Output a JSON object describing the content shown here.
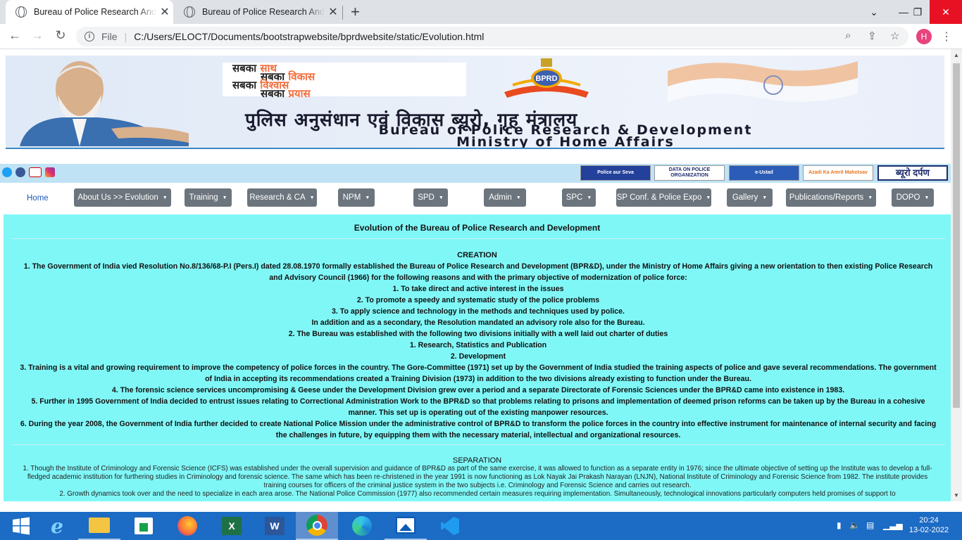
{
  "browser": {
    "tabs": [
      {
        "title": "Bureau of Police Research And Development",
        "active": true
      },
      {
        "title": "Bureau of Police Research And Development",
        "active": false
      }
    ],
    "new_tab": "+",
    "url_label": "File",
    "url": "C:/Users/ELOCT/Documents/bootstrapwebsite/bprdwebsite/static/Evolution.html",
    "profile_initial": "H"
  },
  "banner": {
    "slogan": {
      "line1_a": "सबका",
      "line1_b": "साथ",
      "line2_a": "सबका",
      "line2_b": "विकास",
      "line3_a": "सबका",
      "line3_b": "विश्वास",
      "line4_a": "सबका",
      "line4_b": "प्रयास"
    },
    "logo_text": "BPRD",
    "hindi_title": "पुलिस अनुसंधान एवं विकास ब्यूरो, गृह मंत्रालय",
    "en_title_1": "Bureau of Police Research & Development",
    "en_title_2": "Ministry of Home Affairs"
  },
  "partners": {
    "p1": "Police aur Seva",
    "p2": "DATA ON POLICE ORGANIZATION",
    "p3": "e-Ustad",
    "p4": "Azadi Ka Amrit Mahotsav",
    "p5": "ब्यूरो दर्पण"
  },
  "nav": {
    "home": "Home",
    "items": [
      "About Us >> Evolution",
      "Training",
      "Research & CA",
      "NPM",
      "SPD",
      "Admin",
      "SPC",
      "SP Conf. & Police Expo",
      "Gallery",
      "Publications/Reports",
      "DOPO"
    ]
  },
  "content": {
    "title": "Evolution of the Bureau of Police Research and Development",
    "creation_heading": "CREATION",
    "creation": [
      "1. The Government of India vied Resolution No.8/136/68-P.I (Pers.I) dated 28.08.1970 formally established the Bureau of Police Research and Development (BPR&D), under the Ministry of Home Affairs giving a new orientation to then existing Police Research and Advisory Council (1966) for the following reasons and with the primary objective of modernization of police force:",
      "1. To take direct and active interest in the issues",
      "2. To promote a speedy and systematic study of the police problems",
      "3. To apply science and technology in the methods and techniques used by police.",
      "In addition and as a secondary, the Resolution mandated an advisory role also for the Bureau.",
      "2. The Bureau was established with the following two divisions initially with a well laid out charter of duties",
      "1. Research, Statistics and Publication",
      "2. Development",
      "3. Training is a vital and growing requirement to improve the competency of police forces in the country. The Gore-Committee (1971) set up by the Government of India studied the training aspects of police and gave several recommendations. The government of India in accepting its recommendations created a Training Division (1973) in addition to the two divisions already existing to function under the Bureau.",
      "4. The forensic science services uncompromising & Geese under the Development Division grew over a period and a separate Directorate of Forensic Sciences under the BPR&D came into existence in 1983.",
      "5. Further in 1995 Government of India decided to entrust issues relating to Correctional Administration Work to the BPR&D so that problems relating to prisons and implementation of deemed prison reforms can be taken up by the Bureau in a cohesive manner. This set up is operating out of the existing manpower resources.",
      "6. During the year 2008, the Government of India further decided to create National Police Mission under the administrative control of BPR&D to transform the police forces in the country into effective instrument for maintenance of internal security and facing the challenges in future, by equipping them with the necessary material, intellectual and organizational resources."
    ],
    "separation_heading": "SEPARATION",
    "separation": [
      "1. Though the Institute of Criminology and Forensic Science (ICFS) was established under the overall supervision and guidance of BPR&D as part of the same exercise, it was allowed to function as a separate entity in 1976; since the ultimate objective of setting up the Institute was to develop a full-fledged academic institution for furthering studies in Criminology and forensic science. The same which has been re-christened in the year 1991 is now functioning as Lok Nayak Jai Prakash Narayan (LNJN), National Institute of Criminology and Forensic Science from 1982. The institute provides training courses for officers of the criminal justice system in the two subjects i.e. Criminology and Forensic Science and carries out research.",
      "2. Growth dynamics took over and the need to specialize in each area arose. The National Police Commission (1977) also recommended certain measures requiring implementation. Simultaneously, technological innovations particularly computers held promises of support to"
    ]
  },
  "taskbar": {
    "time": "20:24",
    "date": "13-02-2022"
  },
  "colors": {
    "content_bg": "#80f7f7",
    "nav_button": "#6c757d",
    "taskbar": "#1c6bc4"
  }
}
